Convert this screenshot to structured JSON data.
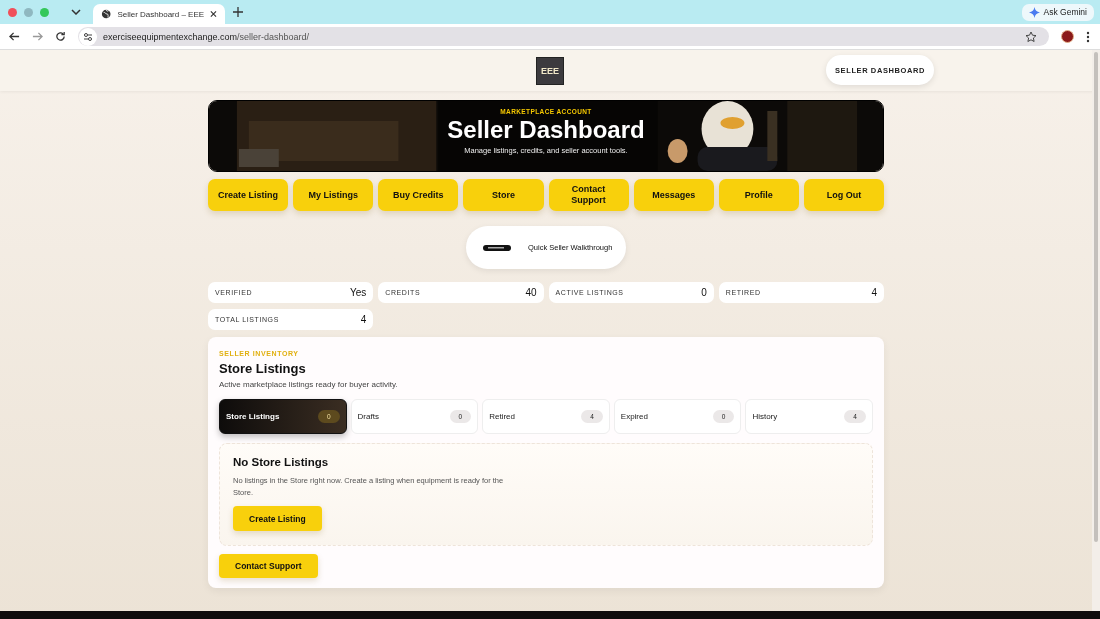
{
  "browser": {
    "tab_title": "Seller Dashboard – EEE",
    "url_host": "exerciseequipmentexchange.com",
    "url_path": "/seller-dashboard/",
    "ask_button": "Ask Gemini"
  },
  "header": {
    "logo_text": "EEE",
    "pill": "SELLER DASHBOARD"
  },
  "hero": {
    "eyebrow": "MARKETPLACE ACCOUNT",
    "title": "Seller Dashboard",
    "subtitle": "Manage listings, credits, and seller account tools."
  },
  "nav_buttons": [
    "Create Listing",
    "My Listings",
    "Buy Credits",
    "Store",
    "Contact Support",
    "Messages",
    "Profile",
    "Log Out"
  ],
  "walkthrough": {
    "label": "Quick Seller Walkthrough"
  },
  "stats": [
    {
      "label": "VERIFIED",
      "value": "Yes"
    },
    {
      "label": "CREDITS",
      "value": "40"
    },
    {
      "label": "ACTIVE LISTINGS",
      "value": "0"
    },
    {
      "label": "RETIRED",
      "value": "4"
    },
    {
      "label": "TOTAL LISTINGS",
      "value": "4"
    }
  ],
  "inventory": {
    "eyebrow": "SELLER INVENTORY",
    "title": "Store Listings",
    "subtitle": "Active marketplace listings ready for buyer activity.",
    "tabs": [
      {
        "label": "Store Listings",
        "count": "0",
        "selected": true
      },
      {
        "label": "Drafts",
        "count": "0",
        "selected": false
      },
      {
        "label": "Retired",
        "count": "4",
        "selected": false
      },
      {
        "label": "Expired",
        "count": "0",
        "selected": false
      },
      {
        "label": "History",
        "count": "4",
        "selected": false
      }
    ],
    "empty": {
      "title": "No Store Listings",
      "text": "No listings in the Store right now. Create a listing when equipment is ready for the Store.",
      "button": "Create Listing"
    },
    "support_button": "Contact Support"
  }
}
